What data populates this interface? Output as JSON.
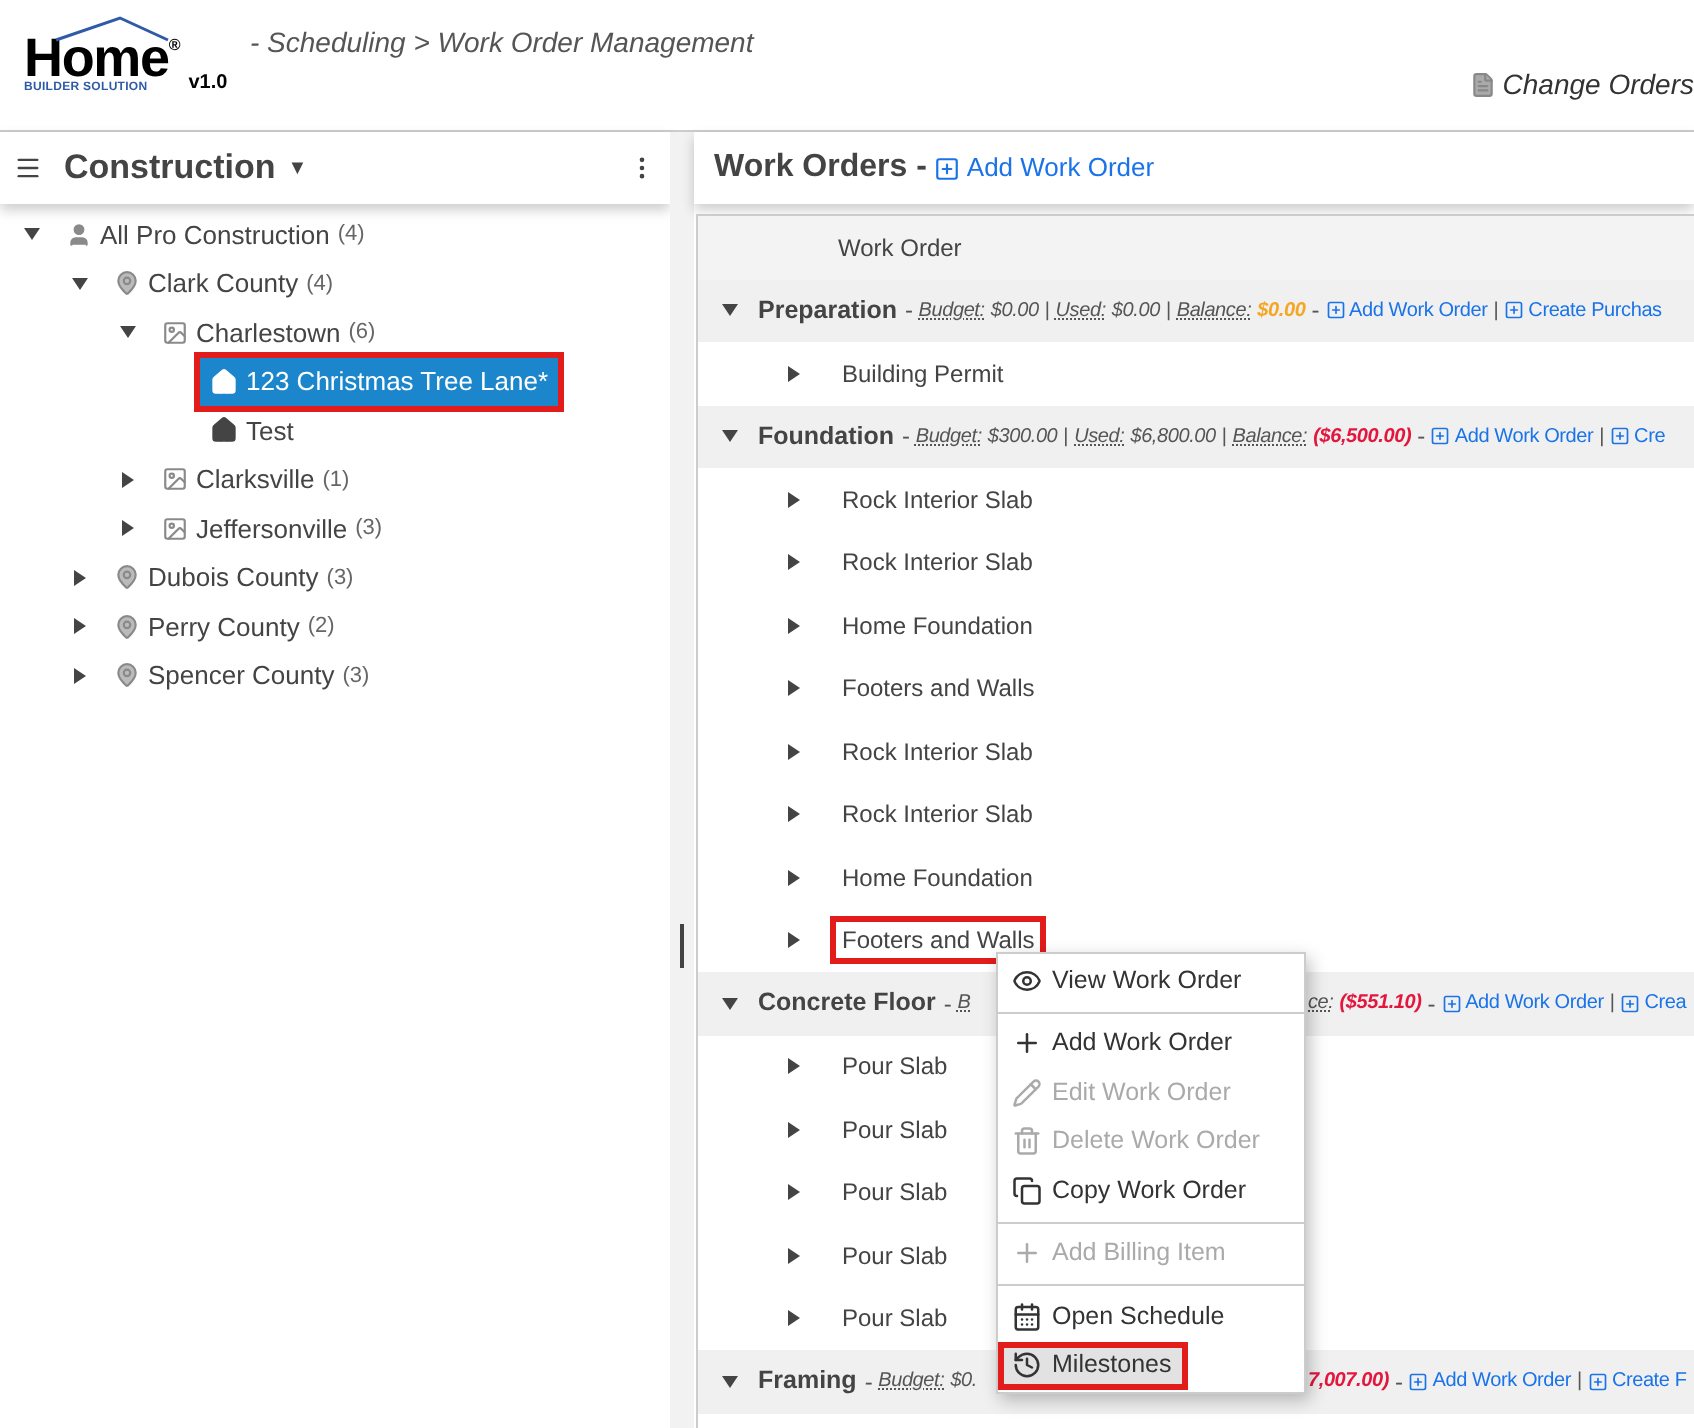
{
  "header": {
    "logo_word": "Home",
    "logo_tagline": "BUILDER SOLUTION",
    "logo_mark": "®",
    "version": "v1.0",
    "breadcrumb": "- Scheduling > Work Order Management",
    "action": "Change Orders"
  },
  "sidebar": {
    "title": "Construction",
    "caret": "▼",
    "tree": [
      {
        "label": "All Pro Construction",
        "count": "(4)",
        "kind": "person",
        "expanded": true,
        "selected": false,
        "annotated": false,
        "children": [
          {
            "label": "Clark County",
            "count": "(4)",
            "kind": "county",
            "expanded": true,
            "selected": false,
            "annotated": false,
            "children": [
              {
                "label": "Charlestown",
                "count": "(6)",
                "kind": "city",
                "expanded": true,
                "selected": false,
                "annotated": false,
                "children": [
                  {
                    "label": "123 Christmas Tree Lane*",
                    "kind": "lot",
                    "selected": true,
                    "annotated": true
                  },
                  {
                    "label": "Test",
                    "kind": "lot",
                    "selected": false,
                    "annotated": false
                  }
                ]
              },
              {
                "label": "Clarksville",
                "count": "(1)",
                "kind": "city",
                "expanded": false,
                "selected": false,
                "annotated": false
              },
              {
                "label": "Jeffersonville",
                "count": "(3)",
                "kind": "city",
                "expanded": false,
                "selected": false,
                "annotated": false
              }
            ]
          },
          {
            "label": "Dubois County",
            "count": "(3)",
            "kind": "county",
            "expanded": false,
            "selected": false,
            "annotated": false
          },
          {
            "label": "Perry County",
            "count": "(2)",
            "kind": "county",
            "expanded": false,
            "selected": false,
            "annotated": false
          },
          {
            "label": "Spencer County",
            "count": "(3)",
            "kind": "county",
            "expanded": false,
            "selected": false,
            "annotated": false
          }
        ]
      }
    ]
  },
  "work_orders": {
    "title": "Work Orders -",
    "add_link": "Add Work Order",
    "column_header": "Work Order",
    "rows": [
      {
        "kind": "group",
        "name": "Preparation",
        "expanded": true,
        "summary": [
          {
            "kind": "dash",
            "text": "-"
          },
          {
            "kind": "label",
            "text": "Budget:"
          },
          {
            "kind": "value",
            "text": "$0.00"
          },
          {
            "kind": "pipe",
            "text": "|"
          },
          {
            "kind": "label",
            "text": "Used:"
          },
          {
            "kind": "value",
            "text": "$0.00"
          },
          {
            "kind": "pipe",
            "text": "|"
          },
          {
            "kind": "label",
            "text": "Balance:"
          },
          {
            "kind": "balance",
            "text": "$0.00",
            "color": "#f5a623"
          },
          {
            "kind": "dash",
            "text": "-"
          },
          {
            "kind": "link",
            "text": "Add Work Order"
          },
          {
            "kind": "pipe",
            "text": "|"
          },
          {
            "kind": "link",
            "text": "Create Purchas"
          }
        ]
      },
      {
        "kind": "item",
        "name": "Building Permit",
        "annotated": false
      },
      {
        "kind": "group",
        "name": "Foundation",
        "expanded": true,
        "summary": [
          {
            "kind": "dash",
            "text": "-"
          },
          {
            "kind": "label",
            "text": "Budget:"
          },
          {
            "kind": "value",
            "text": "$300.00"
          },
          {
            "kind": "pipe",
            "text": "|"
          },
          {
            "kind": "label",
            "text": "Used:"
          },
          {
            "kind": "value",
            "text": "$6,800.00"
          },
          {
            "kind": "pipe",
            "text": "|"
          },
          {
            "kind": "label",
            "text": "Balance:"
          },
          {
            "kind": "balance",
            "text": "($6,500.00)",
            "color": "#e3173e"
          },
          {
            "kind": "dash",
            "text": "-"
          },
          {
            "kind": "link",
            "text": "Add Work Order"
          },
          {
            "kind": "pipe",
            "text": "|"
          },
          {
            "kind": "link",
            "text": "Cre"
          }
        ]
      },
      {
        "kind": "item",
        "name": "Rock Interior Slab",
        "annotated": false
      },
      {
        "kind": "item",
        "name": "Rock Interior Slab",
        "annotated": false
      },
      {
        "kind": "item",
        "name": "Home Foundation",
        "annotated": false
      },
      {
        "kind": "item",
        "name": "Footers and Walls",
        "annotated": false
      },
      {
        "kind": "item",
        "name": "Rock Interior Slab",
        "annotated": false
      },
      {
        "kind": "item",
        "name": "Rock Interior Slab",
        "annotated": false
      },
      {
        "kind": "item",
        "name": "Home Foundation",
        "annotated": false
      },
      {
        "kind": "item",
        "name": "Footers and Walls",
        "annotated": true
      },
      {
        "kind": "group",
        "name": "Concrete Floor",
        "expanded": true,
        "summary": [
          {
            "kind": "dash",
            "text": "-"
          },
          {
            "kind": "label",
            "text": "B"
          }
        ],
        "summary_after_menu": [
          {
            "kind": "label",
            "text": "ce:"
          },
          {
            "kind": "balance",
            "text": "($551.10)",
            "color": "#e3173e"
          },
          {
            "kind": "dash",
            "text": "-"
          },
          {
            "kind": "link",
            "text": "Add Work Order"
          },
          {
            "kind": "pipe",
            "text": "|"
          },
          {
            "kind": "link",
            "text": "Crea"
          }
        ]
      },
      {
        "kind": "item",
        "name": "Pour Slab",
        "annotated": false
      },
      {
        "kind": "item",
        "name": "Pour Slab",
        "annotated": false
      },
      {
        "kind": "item",
        "name": "Pour Slab",
        "annotated": false
      },
      {
        "kind": "item",
        "name": "Pour Slab",
        "annotated": false
      },
      {
        "kind": "item",
        "name": "Pour Slab",
        "annotated": false
      },
      {
        "kind": "group",
        "name": "Framing",
        "expanded": true,
        "summary": [
          {
            "kind": "dash",
            "text": "-"
          },
          {
            "kind": "label",
            "text": "Budget:"
          },
          {
            "kind": "value",
            "text": "$0."
          }
        ],
        "summary_after_menu": [
          {
            "kind": "balance",
            "text": "7,007.00)",
            "color": "#e3173e"
          },
          {
            "kind": "dash",
            "text": "-"
          },
          {
            "kind": "link",
            "text": "Add Work Order"
          },
          {
            "kind": "pipe",
            "text": "|"
          },
          {
            "kind": "link",
            "text": "Create F"
          }
        ]
      }
    ]
  },
  "context_menu": {
    "items": [
      {
        "label": "View Work Order",
        "kind": "view",
        "disabled": false,
        "hovered": false,
        "annotated": false,
        "divider_before": false
      },
      {
        "label": "Add Work Order",
        "kind": "add",
        "disabled": false,
        "hovered": false,
        "annotated": false,
        "divider_before": true
      },
      {
        "label": "Edit Work Order",
        "kind": "edit",
        "disabled": true,
        "hovered": false,
        "annotated": false,
        "divider_before": false
      },
      {
        "label": "Delete Work Order",
        "kind": "delete",
        "disabled": true,
        "hovered": false,
        "annotated": false,
        "divider_before": false
      },
      {
        "label": "Copy Work Order",
        "kind": "copy",
        "disabled": false,
        "hovered": false,
        "annotated": false,
        "divider_before": false
      },
      {
        "label": "Add Billing Item",
        "kind": "add",
        "disabled": true,
        "hovered": false,
        "annotated": false,
        "divider_before": true
      },
      {
        "label": "Open Schedule",
        "kind": "schedule",
        "disabled": false,
        "hovered": false,
        "annotated": false,
        "divider_before": true
      },
      {
        "label": "Milestones",
        "kind": "milestones",
        "disabled": false,
        "hovered": true,
        "annotated": true,
        "divider_before": false
      }
    ]
  }
}
